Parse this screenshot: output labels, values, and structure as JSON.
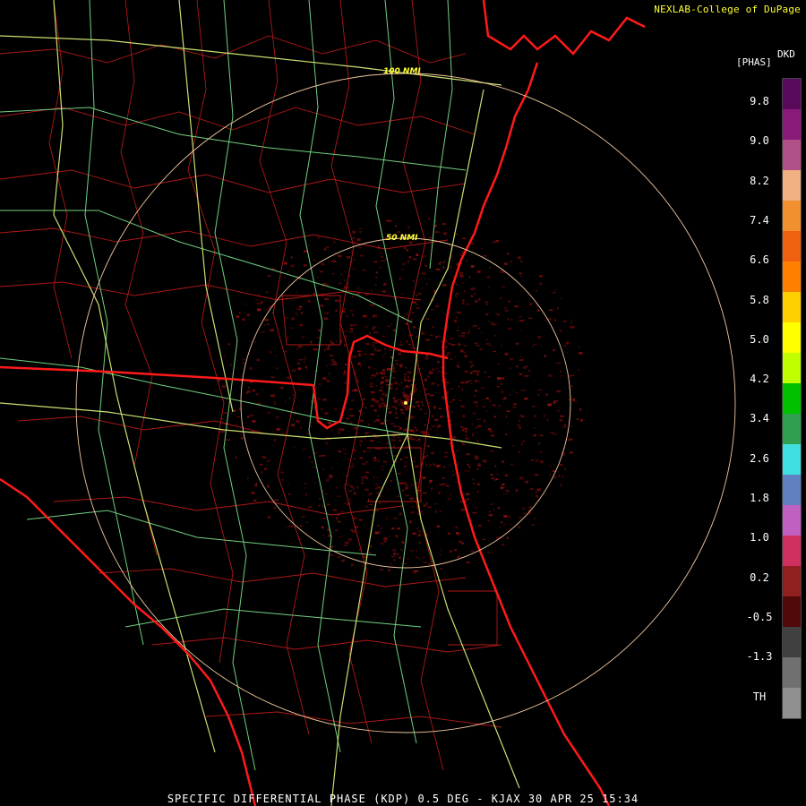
{
  "credit": "NEXLAB-College of DuPage",
  "unit": {
    "top": "DKD",
    "sub": "[PHAS]"
  },
  "caption": "SPECIFIC DIFFERENTIAL PHASE (KDP) 0.5 DEG - KJAX 30 APR 25 15:34",
  "ring_labels": {
    "outer": "100 NMI",
    "inner": "50 NMI"
  },
  "colorbar": {
    "ticks": [
      "9.8",
      "9.0",
      "8.2",
      "7.4",
      "6.6",
      "5.8",
      "5.0",
      "4.2",
      "3.4",
      "2.6",
      "1.8",
      "1.0",
      "0.2",
      "-0.5",
      "-1.3",
      "TH"
    ],
    "colors": [
      "#5a0a5a",
      "#8a1a7a",
      "#b05088",
      "#f0b080",
      "#f09030",
      "#f06010",
      "#ff8000",
      "#ffd000",
      "#ffff00",
      "#c0ff00",
      "#00c000",
      "#30a050",
      "#40e0e0",
      "#6080c0",
      "#c060c0",
      "#d03060",
      "#902020",
      "#500808",
      "#404040",
      "#707070",
      "#909090"
    ]
  },
  "colors": {
    "state_border": "#ff1a1a",
    "county_border": "#b01818",
    "highways": "#c8e070",
    "roads": "#70d080",
    "range_rings": "#f0c8a0",
    "echo": "#6a0a0a"
  }
}
